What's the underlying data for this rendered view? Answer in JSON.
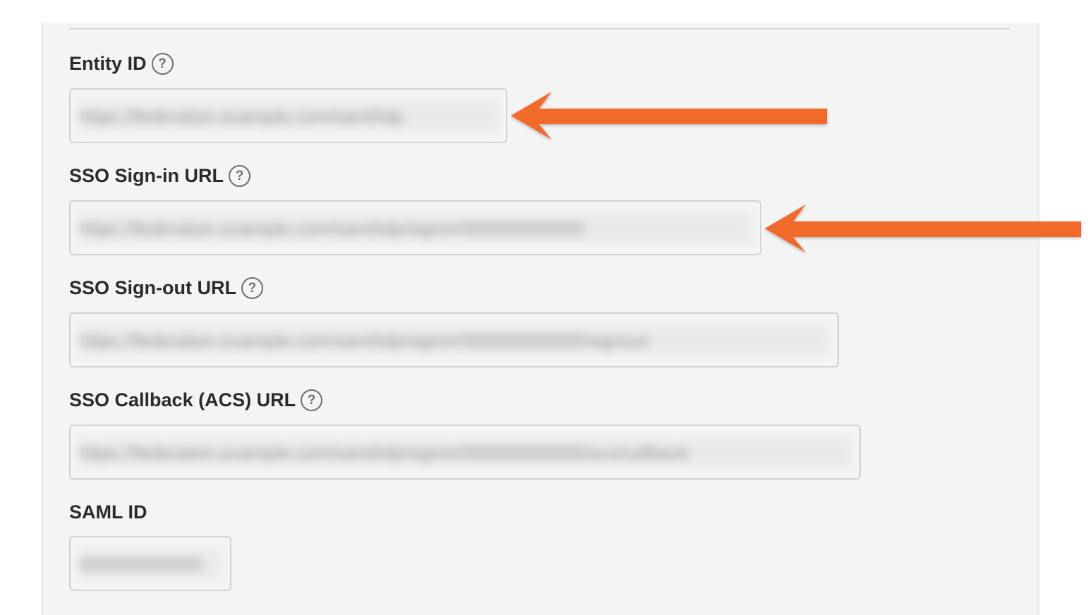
{
  "fields": [
    {
      "label": "Entity ID",
      "has_help": true,
      "value": "https://federation.example.com/saml/idp",
      "help_icon": "question-circle-icon"
    },
    {
      "label": "SSO Sign-in URL",
      "has_help": true,
      "value": "https://federation.example.com/saml/idp/signin/000000000000",
      "help_icon": "question-circle-icon"
    },
    {
      "label": "SSO Sign-out URL",
      "has_help": true,
      "value": "https://federation.example.com/saml/idp/signin/000000000000/signout",
      "help_icon": "question-circle-icon"
    },
    {
      "label": "SSO Callback (ACS) URL",
      "has_help": true,
      "value": "https://federation.example.com/saml/idp/signin/000000000000/acs/callback",
      "help_icon": "question-circle-icon"
    },
    {
      "label": "SAML ID",
      "has_help": false,
      "value": "000000000000"
    }
  ],
  "help_glyph": "?",
  "annotations": {
    "arrow_color": "#f26a2a",
    "arrow_icon": "left-arrow-icon"
  },
  "colors": {
    "panel_background": "#f4f4f4",
    "field_border": "#d2d2d2",
    "label_text": "#2b2b2b"
  }
}
